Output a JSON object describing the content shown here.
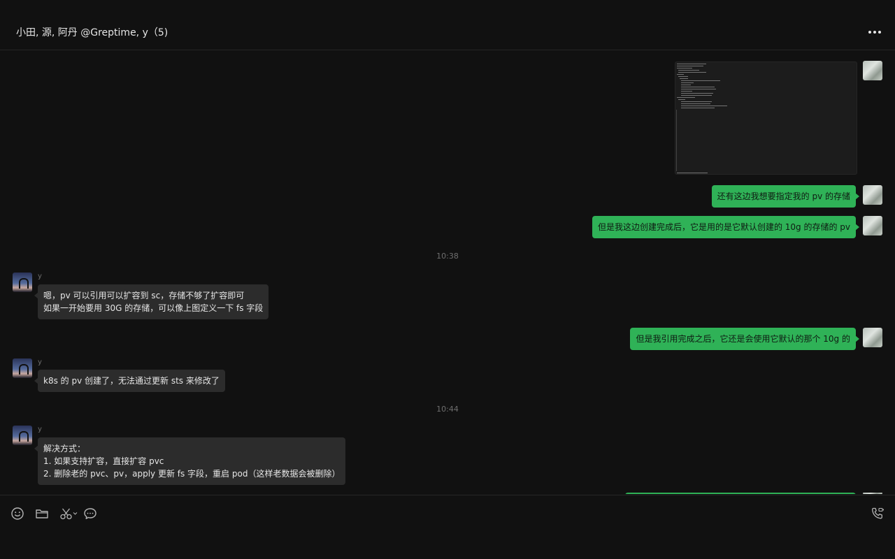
{
  "header": {
    "title": "小田, 源, 阿丹 @Greptime, y（5)",
    "more_icon": "more-icon"
  },
  "messages": [
    {
      "type": "image",
      "from": "me",
      "alt": "terminal-screenshot"
    },
    {
      "type": "text",
      "from": "me",
      "text": "还有这边我想要指定我的 pv 的存储"
    },
    {
      "type": "text",
      "from": "me",
      "text": "但是我这边创建完成后，它是用的是它默认创建的 10g 的存储的 pv"
    },
    {
      "type": "time",
      "text": "10:38"
    },
    {
      "type": "text",
      "from": "y",
      "sender": "y",
      "text": "嗯，pv 可以引用可以扩容到 sc，存储不够了扩容即可\n如果一开始要用 30G 的存储，可以像上图定义一下 fs 字段"
    },
    {
      "type": "text",
      "from": "me",
      "text": "但是我引用完成之后，它还是会使用它默认的那个 10g 的"
    },
    {
      "type": "text",
      "from": "y",
      "sender": "y",
      "text": "k8s 的 pv 创建了，无法通过更新 sts 来修改了"
    },
    {
      "type": "time",
      "text": "10:44"
    },
    {
      "type": "text",
      "from": "y",
      "sender": "y",
      "text": "解决方式：\n1. 如果支持扩容，直接扩容 pvc\n2. 删除老的 pvc、pv，apply 更新 fs 字段，重启 pod（这样老数据会被删除）"
    }
  ],
  "toolbar": {
    "emoji_icon": "emoji-icon",
    "folder_icon": "folder-icon",
    "screenshot_icon": "scissors-icon",
    "chat_history_icon": "chat-bubble-icon",
    "call_icon": "phone-video-icon"
  },
  "colors": {
    "background": "#111111",
    "sent_bubble": "#2fb257",
    "received_bubble": "#2c2c2c"
  }
}
